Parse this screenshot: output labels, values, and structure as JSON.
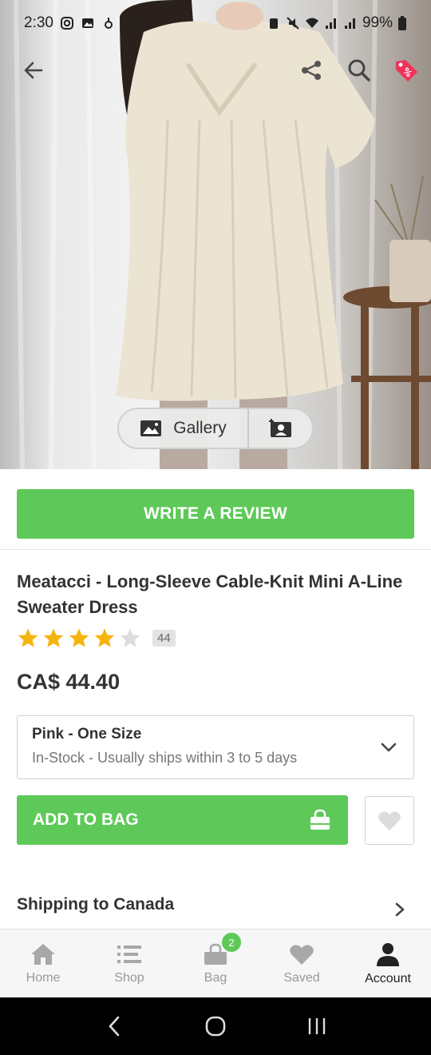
{
  "status_bar": {
    "time": "2:30",
    "battery": "99%"
  },
  "gallery": {
    "label": "Gallery"
  },
  "review_button": {
    "label": "WRITE A REVIEW"
  },
  "product": {
    "title": "Meatacci - Long-Sleeve Cable-Knit Mini A-Line Sweater Dress",
    "rating": 4,
    "review_count": "44",
    "price": "CA$ 44.40"
  },
  "variant": {
    "name": "Pink - One Size",
    "availability": "In-Stock - Usually ships within 3 to 5 days"
  },
  "add_to_bag": {
    "label": "ADD TO BAG"
  },
  "shipping": {
    "label": "Shipping to Canada"
  },
  "tabs": [
    {
      "label": "Home",
      "icon": "home-icon"
    },
    {
      "label": "Shop",
      "icon": "list-icon"
    },
    {
      "label": "Bag",
      "icon": "bag-icon",
      "badge": "2"
    },
    {
      "label": "Saved",
      "icon": "heart-icon"
    },
    {
      "label": "Account",
      "icon": "user-icon",
      "active": true
    }
  ],
  "colors": {
    "accent": "#5ec959",
    "sale_tag": "#f0325a"
  }
}
